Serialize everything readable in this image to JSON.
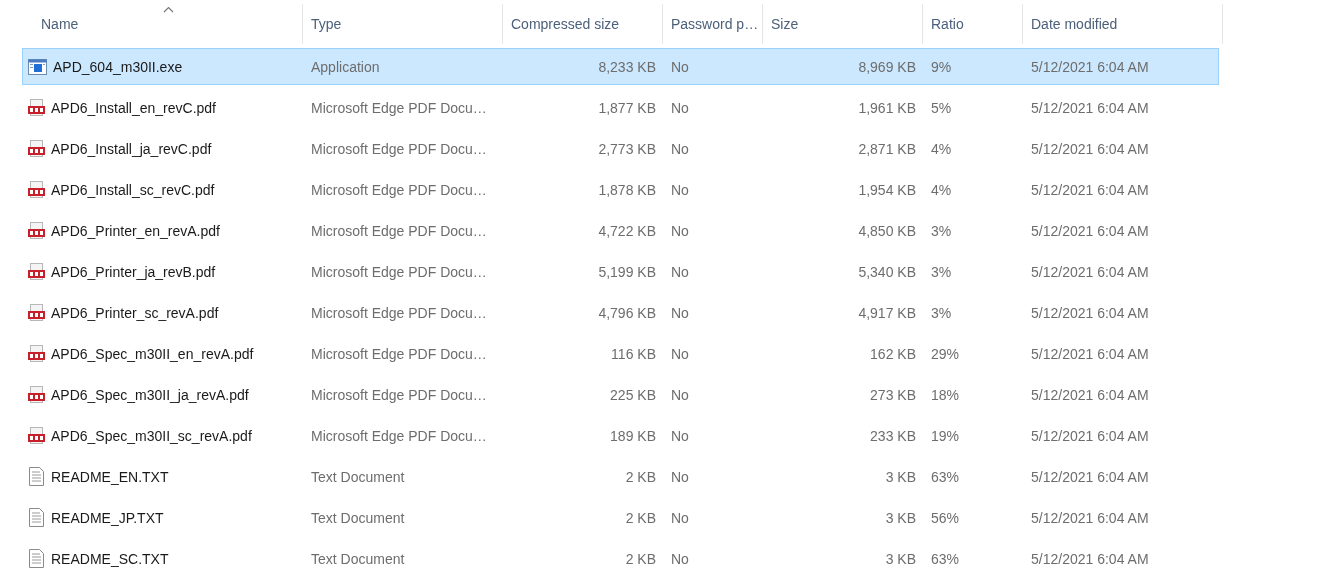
{
  "table": {
    "columns": [
      {
        "label": "Name",
        "sorted": true
      },
      {
        "label": "Type",
        "sorted": false
      },
      {
        "label": "Compressed size",
        "sorted": false
      },
      {
        "label": "Password p…",
        "sorted": false
      },
      {
        "label": "Size",
        "sorted": false
      },
      {
        "label": "Ratio",
        "sorted": false
      },
      {
        "label": "Date modified",
        "sorted": false
      }
    ],
    "rows": [
      {
        "kind": "exe",
        "selected": true,
        "name": "APD_604_m30II.exe",
        "type": "Application",
        "compressed_size": "8,233 KB",
        "password_protected": "No",
        "size": "8,969 KB",
        "ratio": "9%",
        "date_modified": "5/12/2021 6:04 AM"
      },
      {
        "kind": "pdf",
        "selected": false,
        "name": "APD6_Install_en_revC.pdf",
        "type": "Microsoft Edge PDF Docu…",
        "compressed_size": "1,877 KB",
        "password_protected": "No",
        "size": "1,961 KB",
        "ratio": "5%",
        "date_modified": "5/12/2021 6:04 AM"
      },
      {
        "kind": "pdf",
        "selected": false,
        "name": "APD6_Install_ja_revC.pdf",
        "type": "Microsoft Edge PDF Docu…",
        "compressed_size": "2,773 KB",
        "password_protected": "No",
        "size": "2,871 KB",
        "ratio": "4%",
        "date_modified": "5/12/2021 6:04 AM"
      },
      {
        "kind": "pdf",
        "selected": false,
        "name": "APD6_Install_sc_revC.pdf",
        "type": "Microsoft Edge PDF Docu…",
        "compressed_size": "1,878 KB",
        "password_protected": "No",
        "size": "1,954 KB",
        "ratio": "4%",
        "date_modified": "5/12/2021 6:04 AM"
      },
      {
        "kind": "pdf",
        "selected": false,
        "name": "APD6_Printer_en_revA.pdf",
        "type": "Microsoft Edge PDF Docu…",
        "compressed_size": "4,722 KB",
        "password_protected": "No",
        "size": "4,850 KB",
        "ratio": "3%",
        "date_modified": "5/12/2021 6:04 AM"
      },
      {
        "kind": "pdf",
        "selected": false,
        "name": "APD6_Printer_ja_revB.pdf",
        "type": "Microsoft Edge PDF Docu…",
        "compressed_size": "5,199 KB",
        "password_protected": "No",
        "size": "5,340 KB",
        "ratio": "3%",
        "date_modified": "5/12/2021 6:04 AM"
      },
      {
        "kind": "pdf",
        "selected": false,
        "name": "APD6_Printer_sc_revA.pdf",
        "type": "Microsoft Edge PDF Docu…",
        "compressed_size": "4,796 KB",
        "password_protected": "No",
        "size": "4,917 KB",
        "ratio": "3%",
        "date_modified": "5/12/2021 6:04 AM"
      },
      {
        "kind": "pdf",
        "selected": false,
        "name": "APD6_Spec_m30II_en_revA.pdf",
        "type": "Microsoft Edge PDF Docu…",
        "compressed_size": "116 KB",
        "password_protected": "No",
        "size": "162 KB",
        "ratio": "29%",
        "date_modified": "5/12/2021 6:04 AM"
      },
      {
        "kind": "pdf",
        "selected": false,
        "name": "APD6_Spec_m30II_ja_revA.pdf",
        "type": "Microsoft Edge PDF Docu…",
        "compressed_size": "225 KB",
        "password_protected": "No",
        "size": "273 KB",
        "ratio": "18%",
        "date_modified": "5/12/2021 6:04 AM"
      },
      {
        "kind": "pdf",
        "selected": false,
        "name": "APD6_Spec_m30II_sc_revA.pdf",
        "type": "Microsoft Edge PDF Docu…",
        "compressed_size": "189 KB",
        "password_protected": "No",
        "size": "233 KB",
        "ratio": "19%",
        "date_modified": "5/12/2021 6:04 AM"
      },
      {
        "kind": "txt",
        "selected": false,
        "name": "README_EN.TXT",
        "type": "Text Document",
        "compressed_size": "2 KB",
        "password_protected": "No",
        "size": "3 KB",
        "ratio": "63%",
        "date_modified": "5/12/2021 6:04 AM"
      },
      {
        "kind": "txt",
        "selected": false,
        "name": "README_JP.TXT",
        "type": "Text Document",
        "compressed_size": "2 KB",
        "password_protected": "No",
        "size": "3 KB",
        "ratio": "56%",
        "date_modified": "5/12/2021 6:04 AM"
      },
      {
        "kind": "txt",
        "selected": false,
        "name": "README_SC.TXT",
        "type": "Text Document",
        "compressed_size": "2 KB",
        "password_protected": "No",
        "size": "3 KB",
        "ratio": "63%",
        "date_modified": "5/12/2021 6:04 AM"
      }
    ]
  }
}
